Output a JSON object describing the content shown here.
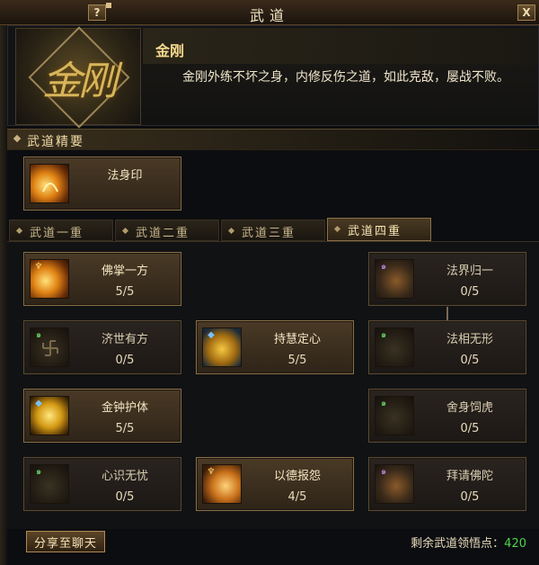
{
  "window": {
    "title": "武道",
    "help_label": "?",
    "close_label": "X"
  },
  "style": {
    "emblem_glyph": "金刚",
    "name": "金刚",
    "description": "金刚外练不坏之身，内修反伤之道，如此克敌，屡战不败。"
  },
  "section": {
    "label": "武道精要"
  },
  "essence": {
    "name": "法身印",
    "icon": "fire-palm-icon"
  },
  "tabs": [
    {
      "label": "武道一重",
      "active": false
    },
    {
      "label": "武道二重",
      "active": false
    },
    {
      "label": "武道三重",
      "active": false
    },
    {
      "label": "武道四重",
      "active": true
    }
  ],
  "skills": [
    {
      "name": "佛掌一方",
      "level": "5/5",
      "icon": "palm-strike-icon",
      "learned": true
    },
    {
      "name": "法界归一",
      "level": "0/5",
      "icon": "dharma-realm-icon",
      "learned": false
    },
    {
      "name": "济世有方",
      "level": "0/5",
      "icon": "swastika-icon",
      "learned": false
    },
    {
      "name": "持慧定心",
      "level": "5/5",
      "icon": "wisdom-figure-icon",
      "learned": true
    },
    {
      "name": "法相无形",
      "level": "0/5",
      "icon": "dharma-form-icon",
      "learned": false
    },
    {
      "name": "金钟护体",
      "level": "5/5",
      "icon": "golden-bell-icon",
      "learned": true
    },
    {
      "name": "舍身饲虎",
      "level": "0/5",
      "icon": "tiger-sacrifice-icon",
      "learned": false
    },
    {
      "name": "心识无忧",
      "level": "0/5",
      "icon": "mind-calm-icon",
      "learned": false
    },
    {
      "name": "以德报怨",
      "level": "4/5",
      "icon": "virtue-return-icon",
      "learned": true
    },
    {
      "name": "拜请佛陀",
      "level": "0/5",
      "icon": "buddha-invoke-icon",
      "learned": false
    }
  ],
  "footer": {
    "share_label": "分享至聊天",
    "points_label": "剩余武道领悟点：",
    "points_value": "420"
  },
  "colors": {
    "gold_text": "#f3e6c3",
    "points_green": "#4fd34a",
    "card_border": "#8a7049"
  }
}
